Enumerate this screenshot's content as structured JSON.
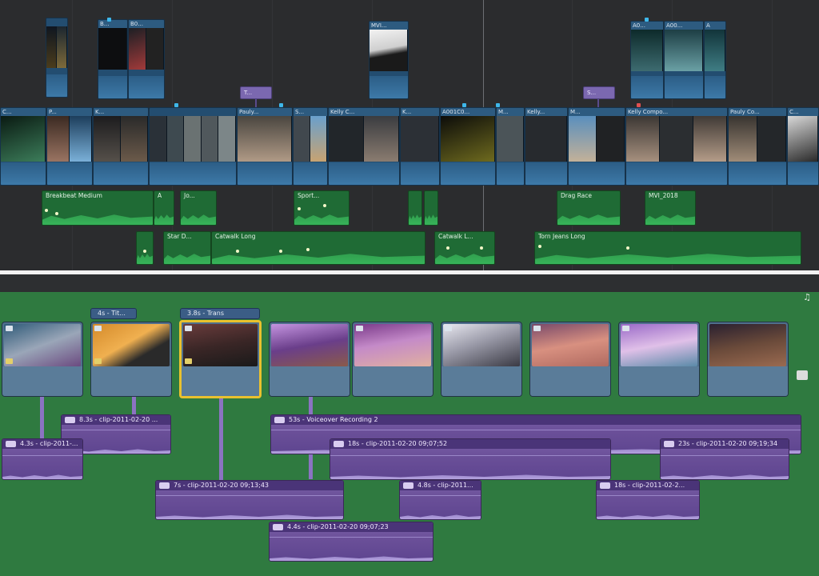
{
  "top_timeline": {
    "primary_clips": [
      {
        "label": "C..."
      },
      {
        "label": "P..."
      },
      {
        "label": "K..."
      },
      {
        "label": "Pauly..."
      },
      {
        "label": "S..."
      },
      {
        "label": "Kelly C..."
      },
      {
        "label": "K..."
      },
      {
        "label": "A001C0..."
      },
      {
        "label": "M..."
      },
      {
        "label": "Kelly..."
      },
      {
        "label": "M..."
      },
      {
        "label": "Kelly Compo..."
      },
      {
        "label": "Pauly Co..."
      },
      {
        "label": "C..."
      }
    ],
    "connected_video": [
      {
        "label": "B..."
      },
      {
        "label": "B0..."
      },
      {
        "label": "MVI..."
      },
      {
        "label": "A0..."
      },
      {
        "label": "A00..."
      },
      {
        "label": "A"
      }
    ],
    "titles": [
      {
        "label": "T..."
      },
      {
        "label": "S..."
      }
    ],
    "green_clips": [
      {
        "label": "Breakbeat Medium"
      },
      {
        "label": "A"
      },
      {
        "label": "Jo..."
      },
      {
        "label": "Sport..."
      },
      {
        "label": "Drag Race"
      },
      {
        "label": "MVI_2018"
      },
      {
        "label": "Star D..."
      },
      {
        "label": "Catwalk Long"
      },
      {
        "label": "Catwalk L..."
      },
      {
        "label": "Torn Jeans Long"
      }
    ]
  },
  "bottom_timeline": {
    "pills": [
      {
        "label": "4s - Tit..."
      },
      {
        "label": "3.8s - Trans"
      }
    ],
    "audio_clips": [
      {
        "label": "8.3s - clip-2011-02-20 ..."
      },
      {
        "label": "53s - Voiceover Recording 2"
      },
      {
        "label": "4.3s - clip-2011-..."
      },
      {
        "label": "18s - clip-2011-02-20 09;07;52"
      },
      {
        "label": "23s - clip-2011-02-20 09;19;34"
      },
      {
        "label": "7s - clip-2011-02-20 09;13;43"
      },
      {
        "label": "4.8s - clip-2011..."
      },
      {
        "label": "18s - clip-2011-02-2..."
      },
      {
        "label": "4.4s - clip-2011-02-20 09;07;23"
      }
    ]
  },
  "colors": {
    "primary_clip": "#234d70",
    "green_audio": "#1f6b35",
    "purple_audio": "#6a4f98",
    "selection": "#e9c12e",
    "timeline_bg_bottom": "#2f7a40"
  }
}
